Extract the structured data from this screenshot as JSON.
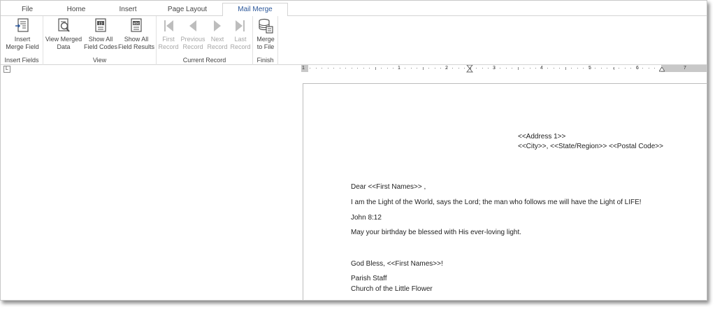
{
  "tabs": [
    "File",
    "Home",
    "Insert",
    "Page Layout",
    "Mail Merge"
  ],
  "ribbon": {
    "insert_fields": {
      "label": "Insert Fields",
      "insert_merge_field": [
        "Insert",
        "Merge Field"
      ]
    },
    "view": {
      "label": "View",
      "view_merged_data": [
        "View Merged",
        "Data"
      ],
      "show_all_field_codes": [
        "Show All",
        "Field Codes"
      ],
      "show_all_field_results": [
        "Show All",
        "Field Results"
      ]
    },
    "current_record": {
      "label": "Current Record",
      "first_record": [
        "First",
        "Record"
      ],
      "previous_record": [
        "Previous",
        "Record"
      ],
      "next_record": [
        "Next",
        "Record"
      ],
      "last_record": [
        "Last",
        "Record"
      ]
    },
    "finish": {
      "label": "Finish",
      "merge_to_file": [
        "Merge",
        "to File"
      ]
    }
  },
  "ruler": {
    "numbers": [
      "1",
      "1",
      "2",
      "3",
      "4",
      "5",
      "6",
      "7"
    ]
  },
  "tab_selector": "L",
  "document": {
    "address_line_1": "<<Address 1>>",
    "address_line_2": "<<City>>, <<State/Region>> <<Postal Code>>",
    "greeting": "Dear <<First Names>> ,",
    "body_1": "I am the Light of the World, says the Lord; the man who follows me will have the Light of LIFE!",
    "body_2": "John 8:12",
    "body_3": "May your birthday be blessed with His ever-loving light.",
    "closing": "God Bless,  <<First Names>>!",
    "signature_1": "Parish Staff",
    "signature_2": "Church of the Little Flower"
  }
}
